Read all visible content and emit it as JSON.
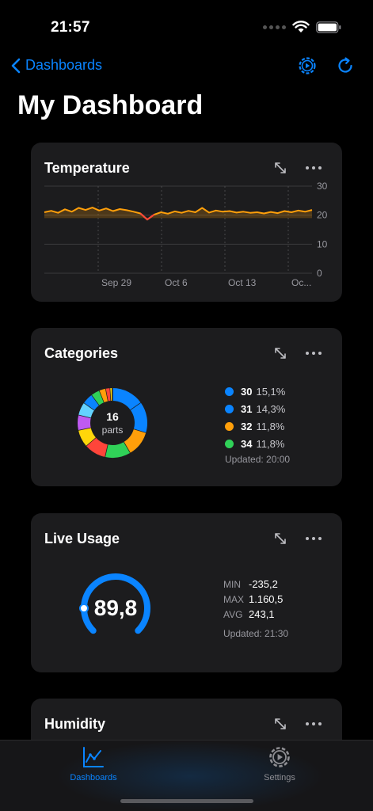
{
  "status": {
    "time": "21:57"
  },
  "nav": {
    "back_label": "Dashboards"
  },
  "page": {
    "title": "My Dashboard"
  },
  "temperature": {
    "title": "Temperature",
    "chart_data": {
      "type": "line",
      "title": "Temperature",
      "xlabel": "",
      "ylabel": "",
      "ylim": [
        0,
        30
      ],
      "y_ticks": [
        "30",
        "20",
        "10",
        "0"
      ],
      "x_ticks": [
        "Sep 29",
        "Oct 6",
        "Oct 13",
        "Oc..."
      ],
      "grid": true,
      "series": [
        {
          "values": [
            21,
            21.5,
            20.8,
            22,
            21.2,
            22.5,
            21.8,
            22.6,
            21.6,
            22.3,
            21.4,
            22.1,
            21.7,
            21.2,
            20.6,
            18.5,
            20.2,
            21,
            20.5,
            21.3,
            20.8,
            21.5,
            21,
            22.5,
            20.9,
            21.6,
            21.2,
            21.4,
            20.9,
            21.2,
            20.8,
            21,
            20.6,
            21.1,
            20.7,
            21.4,
            21,
            21.6,
            21.2,
            21.8
          ]
        }
      ],
      "colors": {
        "line": "#ff9f0a",
        "dip": "#ff453a"
      }
    }
  },
  "categories": {
    "title": "Categories",
    "center_count": "16",
    "center_unit": "parts",
    "legend": [
      {
        "label": "30",
        "pct": "15,1%",
        "color": "#0a84ff"
      },
      {
        "label": "31",
        "pct": "14,3%",
        "color": "#0a84ff"
      },
      {
        "label": "32",
        "pct": "11,8%",
        "color": "#ff9f0a"
      },
      {
        "label": "34",
        "pct": "11,8%",
        "color": "#30d158"
      }
    ],
    "updated": "Updated: 20:00",
    "chart_data": {
      "type": "pie",
      "values": [
        15.1,
        14.3,
        11.8,
        11.8,
        10,
        8,
        7,
        6,
        5,
        4,
        3,
        2,
        1
      ],
      "colors": [
        "#0a84ff",
        "#0a84ff",
        "#ff9f0a",
        "#30d158",
        "#ff453a",
        "#ffd60a",
        "#bf5af2",
        "#64d2ff",
        "#0a84ff",
        "#30d158",
        "#ff9f0a",
        "#ff453a",
        "#ffd60a"
      ]
    }
  },
  "live": {
    "title": "Live Usage",
    "value": "89,8",
    "gauge_fraction": 0.8,
    "stats": [
      {
        "label": "MIN",
        "value": "-235,2"
      },
      {
        "label": "MAX",
        "value": "1.160,5"
      },
      {
        "label": "AVG",
        "value": "243,1"
      }
    ],
    "updated": "Updated: 21:30",
    "color": "#0a84ff"
  },
  "humidity": {
    "title": "Humidity"
  },
  "tabs": {
    "dashboards": "Dashboards",
    "settings": "Settings"
  }
}
